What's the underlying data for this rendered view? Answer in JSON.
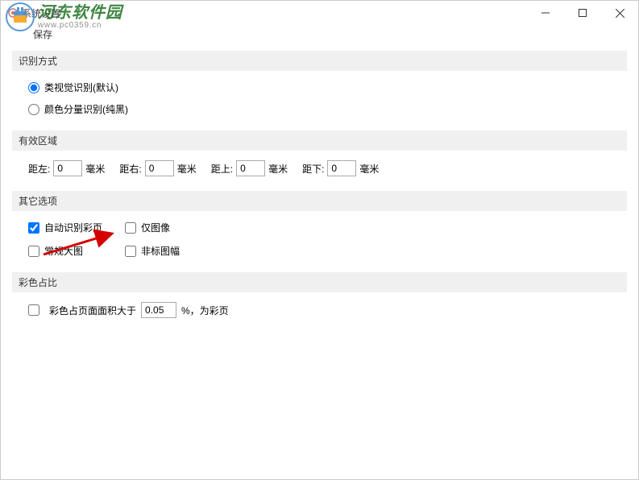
{
  "window": {
    "title": "系统设置"
  },
  "toolbar": {
    "save_label": "保存"
  },
  "watermark": {
    "name_cn": "河东软件园",
    "url": "www.pc0359.cn"
  },
  "sections": {
    "recognition": {
      "title": "识别方式",
      "options": {
        "visual": "类视觉识别(默认)",
        "color_component": "颜色分量识别(纯黑)"
      }
    },
    "area": {
      "title": "有效区域",
      "left_label": "距左:",
      "left_value": "0",
      "right_label": "距右:",
      "right_value": "0",
      "top_label": "距上:",
      "top_value": "0",
      "bottom_label": "距下:",
      "bottom_value": "0",
      "unit": "毫米"
    },
    "other": {
      "title": "其它选项",
      "auto_color_page": "自动识别彩页",
      "image_only": "仅图像",
      "normal_big": "常规大图",
      "non_standard": "非标图幅"
    },
    "ratio": {
      "title": "彩色占比",
      "label_pre": "彩色占页面面积大于",
      "value": "0.05",
      "label_post": "%，为彩页"
    }
  }
}
